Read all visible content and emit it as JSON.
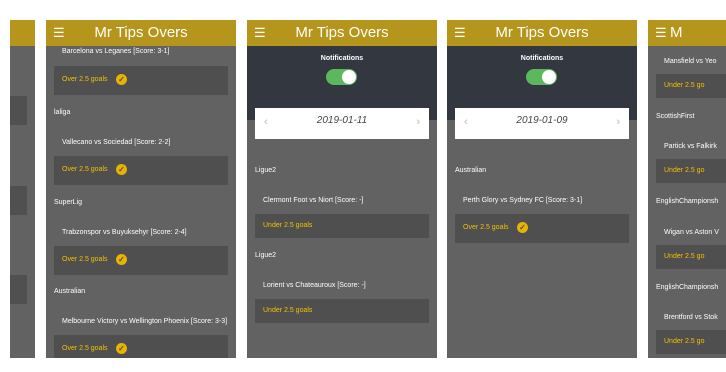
{
  "app": {
    "title": "Mr Tips Overs",
    "menu_icon": "hamburger-menu-icon"
  },
  "screen2": {
    "items": [
      {
        "league": "",
        "match": "Barcelona vs Leganes [Score: 3-1]",
        "result": "Over 2.5 goals",
        "won": true
      },
      {
        "league": "laliga",
        "match": "Vallecano vs Sociedad [Score: 2-2]",
        "result": "Over 2.5 goals",
        "won": true
      },
      {
        "league": "SuperLig",
        "match": "Trabzonspor vs Buyuksehyr [Score: 2-4]",
        "result": "Over 2.5 goals",
        "won": true
      },
      {
        "league": "Australian",
        "match": "Melbourne Victory vs Wellington Phoenix [Score: 3-3]",
        "result": "Over 2.5 goals",
        "won": true
      }
    ]
  },
  "screen3": {
    "notifications_label": "Notifications",
    "notifications_on": true,
    "date": "2019-01-11",
    "items": [
      {
        "league": "Ligue2",
        "match": "Clermont Foot vs Niort [Score: -]",
        "result": "Under 2.5 goals"
      },
      {
        "league": "Ligue2",
        "match": "Lorient vs Chateauroux [Score: -]",
        "result": "Under 2.5 goals"
      }
    ]
  },
  "screen4": {
    "notifications_label": "Notifications",
    "notifications_on": true,
    "date": "2019-01-09",
    "items": [
      {
        "league": "Australian",
        "match": "Perth Glory vs Sydney FC [Score: 3-1]",
        "result": "Over 2.5 goals",
        "won": true
      }
    ]
  },
  "screen5": {
    "items": [
      {
        "league": "",
        "match": "Mansfield vs Yeo",
        "result": "Under 2.5 go"
      },
      {
        "league": "ScottishFirst",
        "match": "Partick vs Falkirk",
        "result": "Under 2.5 go"
      },
      {
        "league": "EnglishChampionsh",
        "match": "Wigan vs Aston V",
        "result": "Under 2.5 go"
      },
      {
        "league": "EnglishChampionsh",
        "match": "Brentford vs Stok",
        "result": "Under 2.5 go"
      }
    ]
  },
  "colors": {
    "header": "#b6951c",
    "background": "#626262",
    "result_row": "#4f4f4f",
    "result_text": "#f2c200",
    "toggle": "#5cb85c"
  }
}
